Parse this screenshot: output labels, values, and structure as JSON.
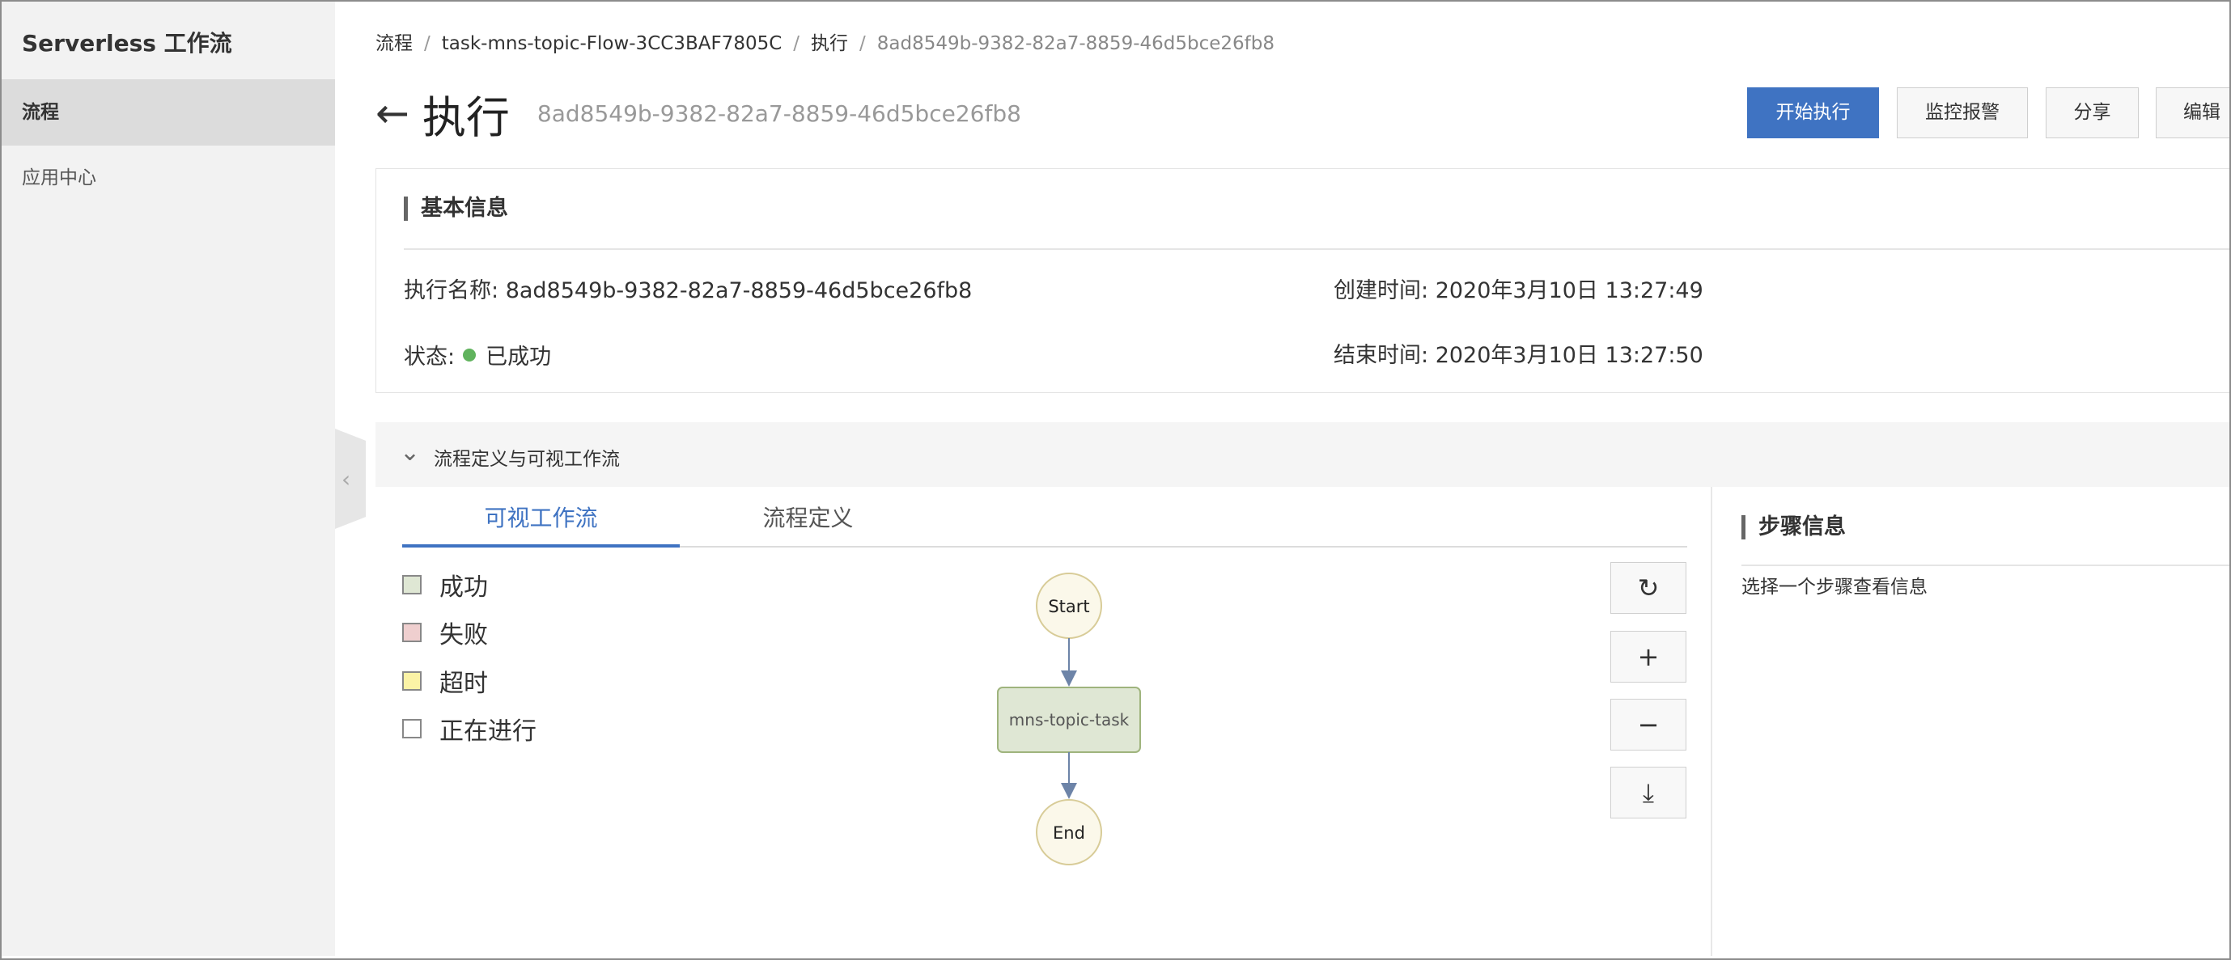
{
  "sidebar": {
    "title": "Serverless 工作流",
    "items": [
      {
        "label": "流程",
        "active": true
      },
      {
        "label": "应用中心",
        "active": false
      }
    ],
    "collapse_icon": "chevron-left-icon"
  },
  "breadcrumb": [
    {
      "label": "流程"
    },
    {
      "label": "task-mns-topic-Flow-3CC3BAF7805C"
    },
    {
      "label": "执行"
    },
    {
      "label": "8ad8549b-9382-82a7-8859-46d5bce26fb8"
    }
  ],
  "header": {
    "back_icon": "arrow-left-icon",
    "title": "执行",
    "subtitle": "8ad8549b-9382-82a7-8859-46d5bce26fb8"
  },
  "actions": {
    "start": "开始执行",
    "monitor": "监控报警",
    "share": "分享",
    "edit": "编辑"
  },
  "basic_info": {
    "heading": "基本信息",
    "exec_name_label": "执行名称: ",
    "exec_name": "8ad8549b-9382-82a7-8859-46d5bce26fb8",
    "status_label": "状态:",
    "status": "已成功",
    "status_color": "#60b35d",
    "created_label": "创建时间: ",
    "created": "2020年3月10日 13:27:49",
    "ended_label": "结束时间: ",
    "ended": "2020年3月10日 13:27:50"
  },
  "flow_section": {
    "label": "流程定义与可视工作流",
    "tabs": [
      {
        "label": "可视工作流",
        "active": true
      },
      {
        "label": "流程定义",
        "active": false
      }
    ]
  },
  "legend": [
    {
      "label": "成功",
      "color": "#dfe7d4"
    },
    {
      "label": "失败",
      "color": "#efcfcf"
    },
    {
      "label": "超时",
      "color": "#fbf3a6"
    },
    {
      "label": "正在进行",
      "color": "#ffffff"
    }
  ],
  "flow": {
    "start": "Start",
    "task": "mns-topic-task",
    "end": "End",
    "task_fill": "#dfe7d4",
    "terminal_fill": "#fbf8ea"
  },
  "tools": [
    {
      "icon": "refresh-icon",
      "glyph": "↻"
    },
    {
      "icon": "zoom-in-icon",
      "glyph": "+"
    },
    {
      "icon": "zoom-out-icon",
      "glyph": "−"
    },
    {
      "icon": "download-icon",
      "glyph": "⤓"
    }
  ],
  "step_info": {
    "heading": "步骤信息",
    "hint": "选择一个步骤查看信息"
  },
  "colors": {
    "primary": "#3f73c2",
    "sidebar_bg": "#f2f2f2",
    "sidebar_active": "#dcdcdc"
  }
}
